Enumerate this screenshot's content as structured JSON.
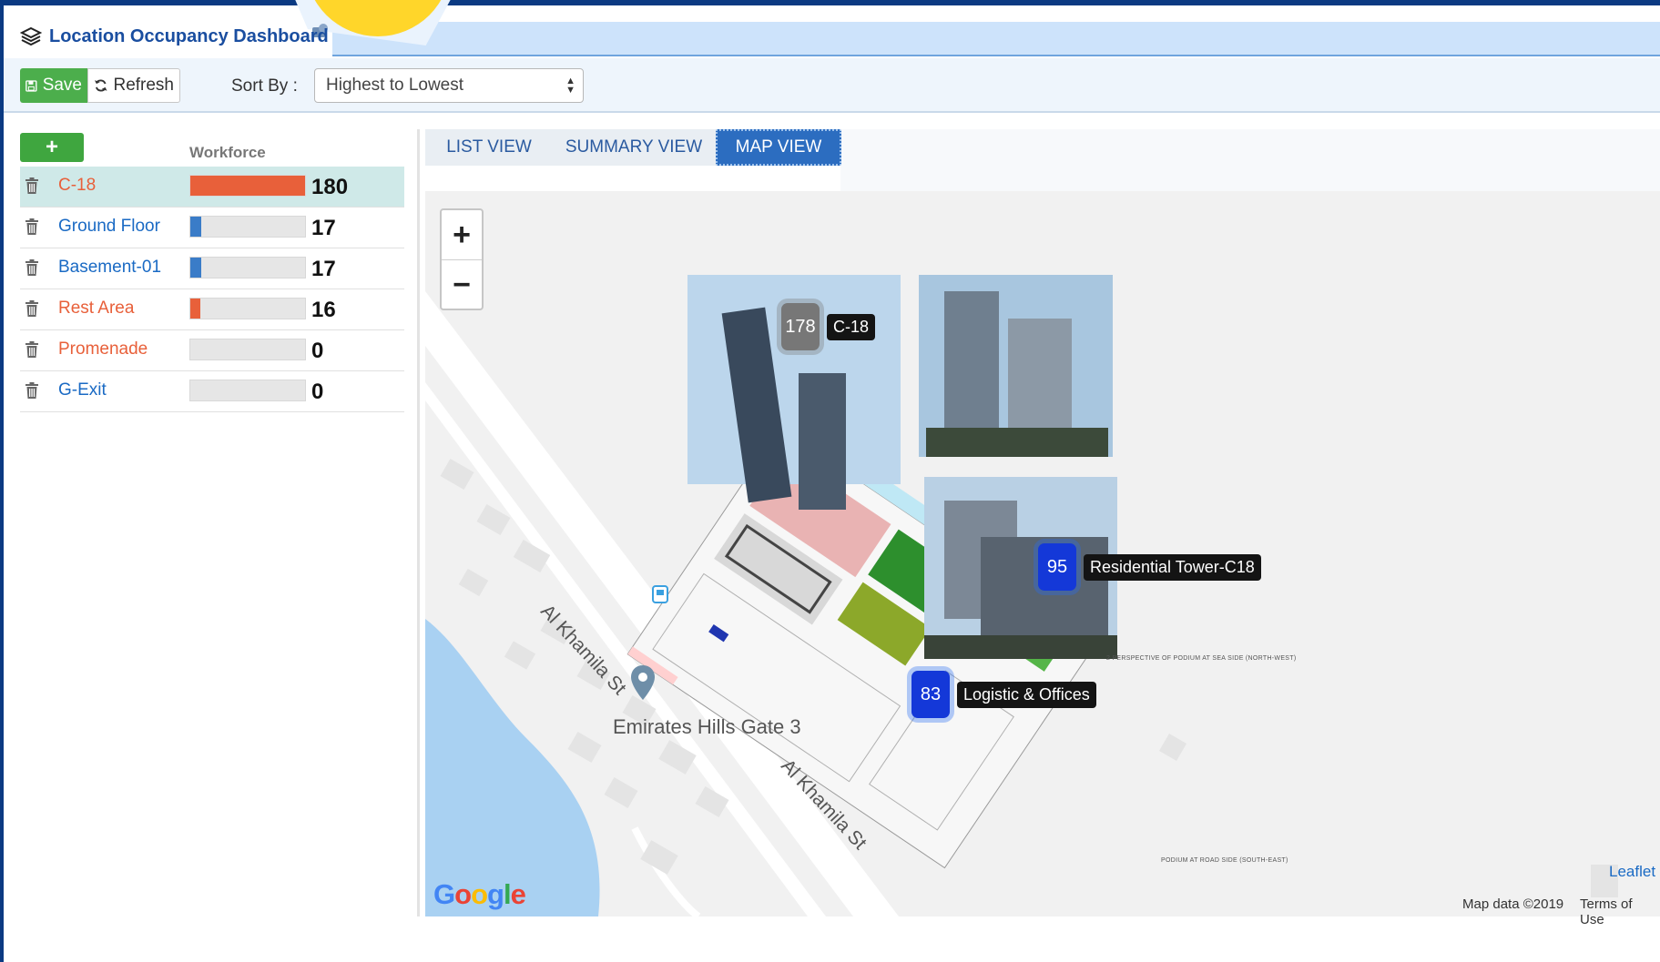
{
  "header": {
    "title": "Location Occupancy Dashboard"
  },
  "toolbar": {
    "save_label": "Save",
    "refresh_label": "Refresh",
    "sort_label": "Sort By :",
    "sort_value": "Highest to Lowest"
  },
  "list": {
    "add_label": "+",
    "workforce_header": "Workforce",
    "items": [
      {
        "name": "C-18",
        "count": "180",
        "fraction": 1.0,
        "color": "#e8603a",
        "name_color": "#e8603a",
        "active": true
      },
      {
        "name": "Ground Floor",
        "count": "17",
        "fraction": 0.094,
        "color": "#3a7cc8",
        "name_color": "#1a6ac4",
        "active": false
      },
      {
        "name": "Basement-01",
        "count": "17",
        "fraction": 0.094,
        "color": "#3a7cc8",
        "name_color": "#1a6ac4",
        "active": false
      },
      {
        "name": "Rest Area",
        "count": "16",
        "fraction": 0.089,
        "color": "#e8603a",
        "name_color": "#e8603a",
        "active": false
      },
      {
        "name": "Promenade",
        "count": "0",
        "fraction": 0,
        "color": "#e8603a",
        "name_color": "#e8603a",
        "active": false
      },
      {
        "name": "G-Exit",
        "count": "0",
        "fraction": 0,
        "color": "#3a7cc8",
        "name_color": "#1a6ac4",
        "active": false
      }
    ]
  },
  "tabs": [
    {
      "label": "LIST VIEW",
      "active": false
    },
    {
      "label": "SUMMARY VIEW",
      "active": false
    },
    {
      "label": "MAP VIEW",
      "active": true
    }
  ],
  "map": {
    "zoom_in": "+",
    "zoom_out": "−",
    "markers": [
      {
        "count": "178",
        "label": "C-18",
        "style": "grey"
      },
      {
        "count": "95",
        "label": "Residential Tower-C18",
        "style": "blue"
      },
      {
        "count": "83",
        "label": "Logistic & Offices",
        "style": "blue"
      }
    ],
    "poi": "Emirates Hills Gate 3",
    "street_upper": "Al Khamila St",
    "street_lower": "Al Khamila St",
    "caption_upper": "2 PERSPECTIVE OF PODIUM AT SEA SIDE (NORTH-WEST)",
    "caption_lower": "PODIUM AT ROAD SIDE (SOUTH-EAST)",
    "google_letters": [
      "G",
      "o",
      "o",
      "g",
      "l",
      "e"
    ],
    "google_colors": [
      "#4285F4",
      "#EA4335",
      "#FBBC05",
      "#4285F4",
      "#34A853",
      "#EA4335"
    ],
    "attr_leaflet": "Leaflet",
    "attr_mapdata": "Map data ©2019",
    "attr_terms": "Terms of Use"
  }
}
